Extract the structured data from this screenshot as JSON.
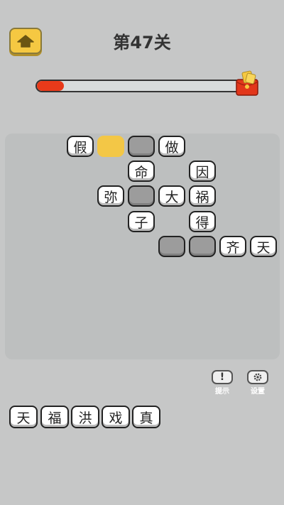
{
  "header": {
    "home_icon": "home-icon",
    "title": "第47关",
    "progress_fraction": 0.13,
    "reward_icon": "red-envelope-icon"
  },
  "board": {
    "tiles": [
      {
        "char": "假",
        "state": "filled"
      },
      {
        "char": "",
        "state": "active"
      },
      {
        "char": "",
        "state": "empty"
      },
      {
        "char": "做",
        "state": "filled"
      },
      {
        "char": "命",
        "state": "filled"
      },
      {
        "char": "因",
        "state": "filled"
      },
      {
        "char": "弥",
        "state": "filled"
      },
      {
        "char": "",
        "state": "empty"
      },
      {
        "char": "大",
        "state": "filled"
      },
      {
        "char": "祸",
        "state": "filled"
      },
      {
        "char": "子",
        "state": "filled"
      },
      {
        "char": "得",
        "state": "filled"
      },
      {
        "char": "",
        "state": "empty"
      },
      {
        "char": "",
        "state": "empty"
      },
      {
        "char": "齐",
        "state": "filled"
      },
      {
        "char": "天",
        "state": "filled"
      }
    ]
  },
  "tools": {
    "hint_label": "提示",
    "hint_icon": "exclamation-icon",
    "settings_label": "设置",
    "settings_icon": "gear-icon"
  },
  "choices": [
    "天",
    "福",
    "洪",
    "戏",
    "真"
  ],
  "colors": {
    "background": "#c6c7c7",
    "accent_yellow": "#f3c746",
    "progress_red": "#e83a1a",
    "empty_tile": "#9c9c9c"
  }
}
